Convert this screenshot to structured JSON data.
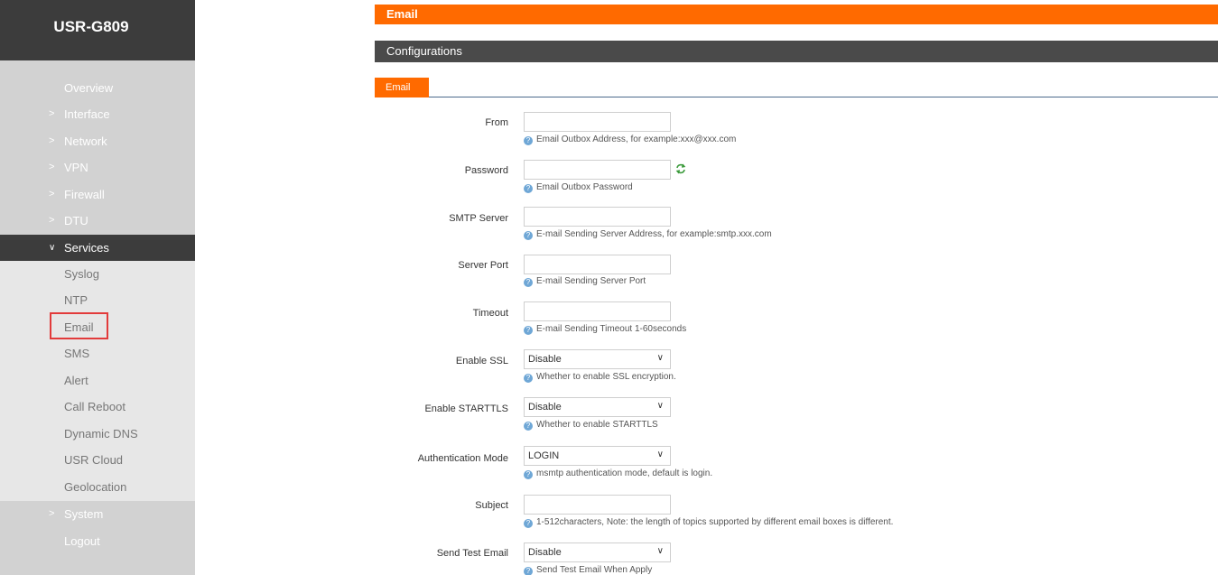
{
  "brand": "USR-G809",
  "nav": {
    "overview": "Overview",
    "interface": "Interface",
    "network": "Network",
    "vpn": "VPN",
    "firewall": "Firewall",
    "dtu": "DTU",
    "services": "Services",
    "system": "System",
    "logout": "Logout"
  },
  "services_menu": [
    "Syslog",
    "NTP",
    "Email",
    "SMS",
    "Alert",
    "Call Reboot",
    "Dynamic DNS",
    "USR Cloud",
    "Geolocation"
  ],
  "page": {
    "title": "Email",
    "section": "Configurations",
    "tab": "Email"
  },
  "form": {
    "from": {
      "label": "From",
      "value": "",
      "hint": "Email Outbox Address, for example:xxx@xxx.com"
    },
    "password": {
      "label": "Password",
      "value": "",
      "hint": "Email Outbox Password"
    },
    "smtp_server": {
      "label": "SMTP Server",
      "value": "",
      "hint": "E-mail Sending Server Address, for example:smtp.xxx.com"
    },
    "server_port": {
      "label": "Server Port",
      "value": "",
      "hint": "E-mail Sending Server Port"
    },
    "timeout": {
      "label": "Timeout",
      "value": "",
      "hint": "E-mail Sending Timeout 1-60seconds"
    },
    "enable_ssl": {
      "label": "Enable SSL",
      "value": "Disable",
      "hint": "Whether to enable SSL encryption."
    },
    "enable_starttls": {
      "label": "Enable STARTTLS",
      "value": "Disable",
      "hint": "Whether to enable STARTTLS"
    },
    "auth_mode": {
      "label": "Authentication Mode",
      "value": "LOGIN",
      "hint": "msmtp authentication mode, default is login."
    },
    "subject": {
      "label": "Subject",
      "value": "",
      "hint": "1-512characters, Note: the length of topics supported by different email boxes is different."
    },
    "send_test": {
      "label": "Send Test Email",
      "value": "Disable",
      "hint": "Send Test Email When Apply"
    }
  },
  "colors": {
    "accent": "#ff6a00",
    "dark": "#3c3c3c",
    "highlight": "#e23b3b"
  }
}
